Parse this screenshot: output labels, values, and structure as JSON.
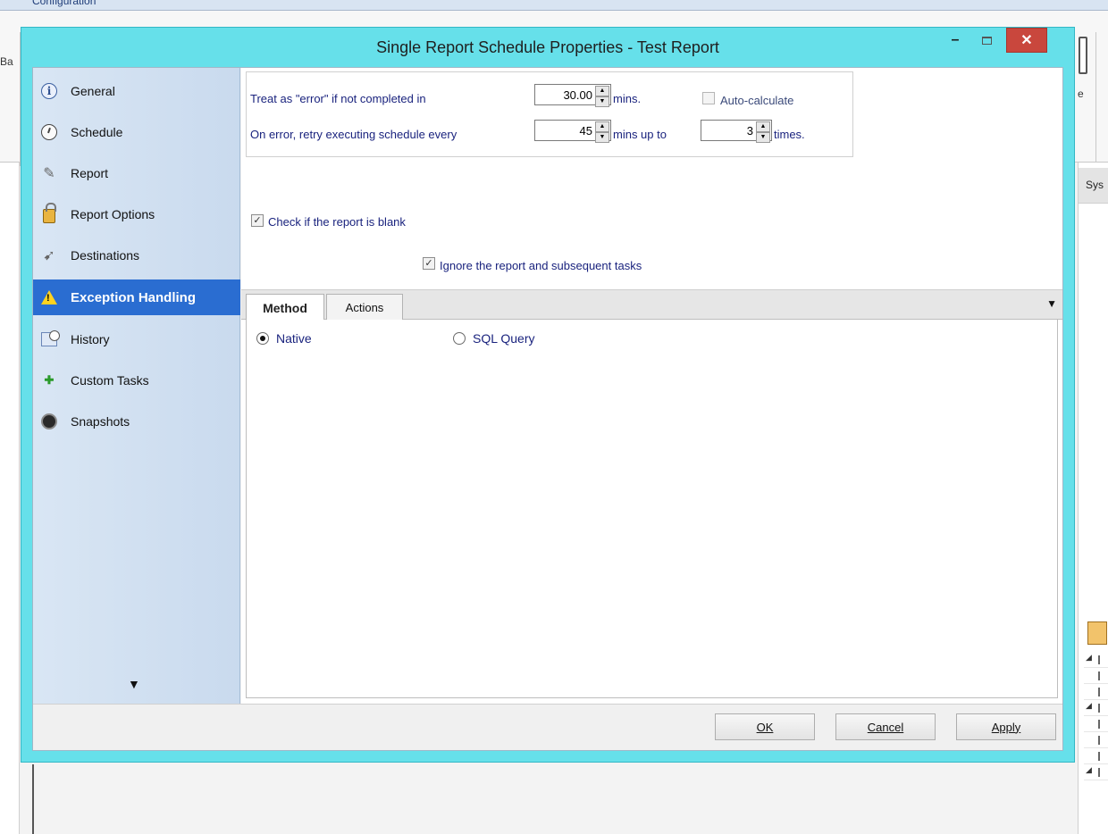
{
  "background": {
    "topbar_label": "Configuration",
    "left_fragment": "Ba",
    "right_fragment": "e",
    "right_panel_header": "Sys"
  },
  "dialog": {
    "title": "Single Report Schedule Properties - Test Report",
    "minimize_glyph": "–",
    "close_glyph": "✕"
  },
  "nav": {
    "items": [
      {
        "label": "General",
        "icon": "info-icon"
      },
      {
        "label": "Schedule",
        "icon": "clock-icon"
      },
      {
        "label": "Report",
        "icon": "pencil-icon"
      },
      {
        "label": "Report Options",
        "icon": "lock-icon"
      },
      {
        "label": "Destinations",
        "icon": "destination-icon"
      },
      {
        "label": "Exception Handling",
        "icon": "warning-icon"
      },
      {
        "label": "History",
        "icon": "history-icon"
      },
      {
        "label": "Custom Tasks",
        "icon": "custom-tasks-icon"
      },
      {
        "label": "Snapshots",
        "icon": "camera-icon"
      }
    ],
    "active_index": 5,
    "more_glyph": "▼"
  },
  "timing": {
    "error_label": "Treat as \"error\" if not completed in",
    "error_value": "30.00",
    "error_unit": "mins.",
    "auto_calculate_label": "Auto-calculate",
    "auto_calculate_checked": false,
    "retry_label": "On error, retry  executing schedule every",
    "retry_value": "45",
    "retry_unit": "mins up to",
    "retry_times_value": "3",
    "retry_times_unit": "times."
  },
  "blank_check": {
    "check_label": "Check if the report is blank",
    "check_checked": true,
    "ignore_label": "Ignore the report and subsequent tasks",
    "ignore_checked": true
  },
  "tabs": {
    "items": [
      "Method",
      "Actions"
    ],
    "active": "Method",
    "menu_glyph": "▼"
  },
  "method": {
    "native_label": "Native",
    "sql_label": "SQL Query",
    "selected": "Native"
  },
  "footer": {
    "ok_label": "OK",
    "cancel_label": "Cancel",
    "apply_label": "Apply"
  }
}
